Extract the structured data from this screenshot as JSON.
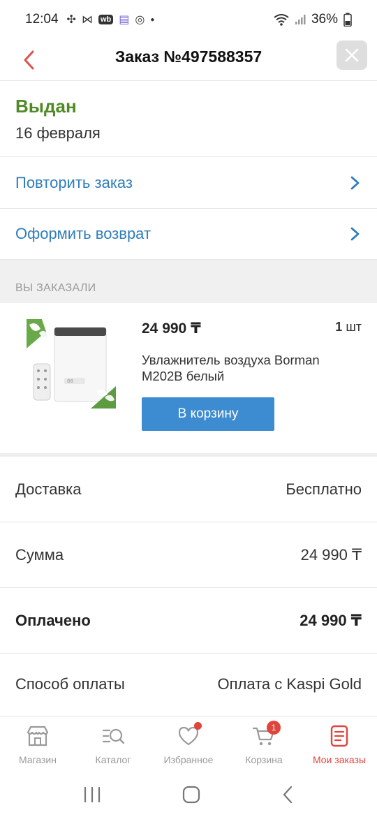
{
  "status_bar": {
    "time": "12:04",
    "battery": "36%",
    "icons": [
      "slack-icon",
      "capcut-icon",
      "wb-app-icon",
      "list-app-icon",
      "chrome-icon",
      "dot-icon"
    ]
  },
  "header": {
    "title": "Заказ №497588357"
  },
  "order_status": {
    "label": "Выдан",
    "date": "16 февраля",
    "color": "#4f8a27"
  },
  "actions": [
    {
      "label": "Повторить заказ"
    },
    {
      "label": "Оформить возврат"
    }
  ],
  "section": {
    "ordered_title": "ВЫ ЗАКАЗАЛИ"
  },
  "product": {
    "price": "24 990 ₸",
    "qty_value": "1",
    "qty_unit": "шт",
    "name": "Увлажнитель воздуха Borman M202B белый",
    "cart_button": "В корзину"
  },
  "summary": [
    {
      "key": "Доставка",
      "value": "Бесплатно"
    },
    {
      "key": "Сумма",
      "value": "24 990 ₸"
    },
    {
      "key": "Оплачено",
      "value": "24 990 ₸"
    },
    {
      "key": "Способ оплаты",
      "value": "Оплата с Kaspi Gold"
    }
  ],
  "tabbar": {
    "items": [
      {
        "label": "Магазин",
        "icon": "store-icon"
      },
      {
        "label": "Каталог",
        "icon": "catalog-search-icon"
      },
      {
        "label": "Избранное",
        "icon": "heart-icon"
      },
      {
        "label": "Корзина",
        "icon": "cart-icon",
        "badge": "1"
      },
      {
        "label": "Мои заказы",
        "icon": "orders-icon"
      }
    ],
    "active_color": "#e0443b"
  },
  "colors": {
    "accent_blue": "#2f7dbb",
    "button_blue": "#3d8bd0",
    "brand_red": "#e0443b"
  }
}
